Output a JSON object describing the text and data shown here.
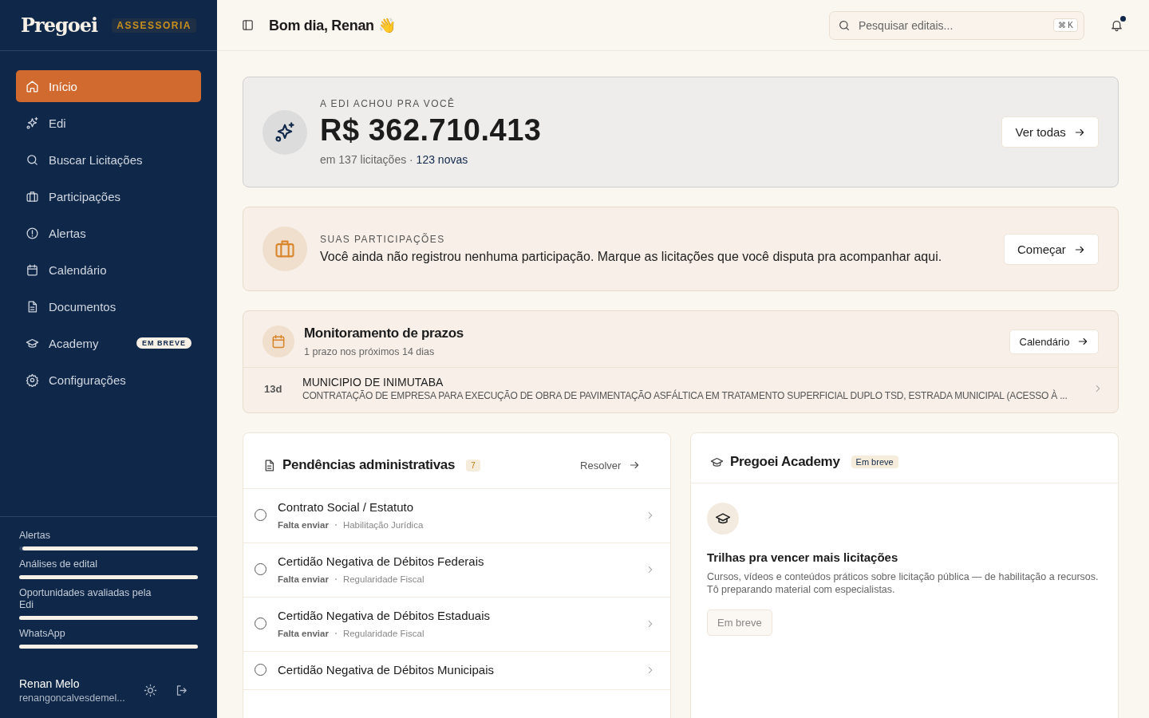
{
  "sidebar": {
    "logo": "Pregoei",
    "plan_badge": "ASSESSORIA",
    "items": [
      {
        "label": "Início",
        "selected": true
      },
      {
        "label": "Edi",
        "selected": false
      },
      {
        "label": "Buscar Licitações",
        "selected": false
      },
      {
        "label": "Participações",
        "selected": false
      },
      {
        "label": "Alertas",
        "selected": false
      },
      {
        "label": "Calendário",
        "selected": false
      },
      {
        "label": "Documentos",
        "selected": false
      },
      {
        "label": "Academy",
        "selected": false,
        "badge": "EM BREVE"
      },
      {
        "label": "Configurações",
        "selected": false
      }
    ],
    "usage": [
      {
        "label": "Alertas",
        "level": 0.98
      },
      {
        "label": "Análises de edital",
        "level": 1
      },
      {
        "label": "Oportunidades avaliadas pela Edi",
        "level": 1
      },
      {
        "label": "WhatsApp",
        "level": 1
      }
    ],
    "user": {
      "name": "Renan Melo",
      "email": "renangoncalvesdemel..."
    }
  },
  "header": {
    "greeting": "Bom dia, Renan",
    "emoji": "👋",
    "search": {
      "placeholder": "Pesquisar editais...",
      "shortcut": "⌘ K"
    },
    "notifications_unread": true
  },
  "edi_card": {
    "eyebrow": "A EDI ACHOU PRA VOCÊ",
    "amount": "R$ 362.710.413",
    "summary": "em 137 licitações · ",
    "highlight": "123 novas",
    "button": "Ver todas"
  },
  "participacoes_card": {
    "eyebrow": "SUAS PARTICIPAÇÕES",
    "text": "Você ainda não registrou nenhuma participação. Marque as licitações que você disputa pra acompanhar aqui.",
    "button": "Começar"
  },
  "prazos_card": {
    "title": "Monitoramento de prazos",
    "subtitle": "1 prazo nos próximos 14 dias",
    "button": "Calendário",
    "items": [
      {
        "days": "13d",
        "org": "MUNICIPIO DE INIMUTABA",
        "description": "CONTRATAÇÃO DE EMPRESA PARA EXECUÇÃO DE OBRA DE PAVIMENTAÇÃO ASFÁLTICA EM TRATAMENTO SUPERFICIAL DUPLO TSD, ESTRADA MUNICIPAL (ACESSO À ..."
      }
    ]
  },
  "pendencias_card": {
    "title": "Pendências administrativas",
    "count": "7",
    "action": "Resolver",
    "items": [
      {
        "title": "Contrato Social / Estatuto",
        "status": "Falta enviar",
        "category": "Habilitação Jurídica",
        "checked": false
      },
      {
        "title": "Certidão Negativa de Débitos Federais",
        "status": "Falta enviar",
        "category": "Regularidade Fiscal",
        "checked": false
      },
      {
        "title": "Certidão Negativa de Débitos Estaduais",
        "status": "Falta enviar",
        "category": "Regularidade Fiscal",
        "checked": false
      },
      {
        "title": "Certidão Negativa de Débitos Municipais",
        "checked": false
      }
    ]
  },
  "academy_card": {
    "title": "Pregoei Academy",
    "badge": "Em breve",
    "heading": "Trilhas pra vencer mais licitações",
    "text": "Cursos, vídeos e conteúdos práticos sobre licitação pública — de habilitação a recursos. Tô preparando material com especialistas.",
    "button": {
      "label": "Em breve",
      "disabled": true
    }
  }
}
